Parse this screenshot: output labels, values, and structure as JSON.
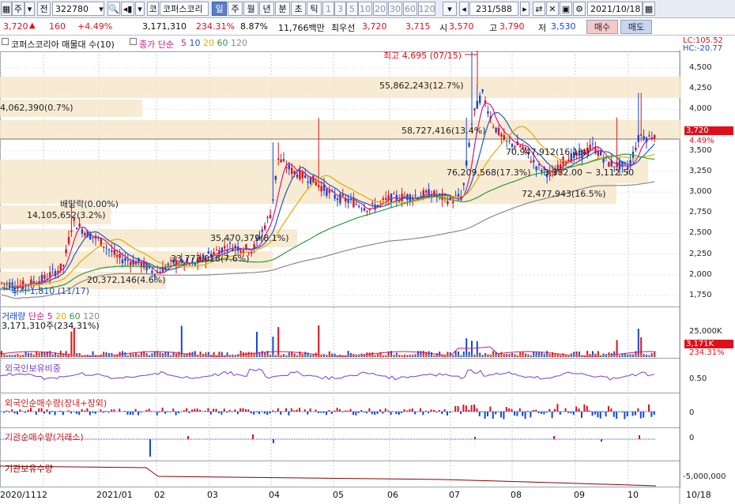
{
  "toolbar": {
    "mode_label": "주",
    "market_label": "전",
    "stock_code": "322780",
    "search_icon": "magnifier-icon",
    "sound_icon": "speaker-icon",
    "code_tag": "코",
    "stock_name": "코퍼스코리",
    "periods": [
      "일",
      "주",
      "월",
      "년",
      "분",
      "초",
      "틱"
    ],
    "active_period": "일",
    "intervals": [
      "1",
      "3",
      "5",
      "10",
      "20",
      "30",
      "60",
      "120"
    ],
    "count": "231/588",
    "date": "2021/10/18"
  },
  "quote": {
    "price": "3,720",
    "change_arrow": "▲",
    "change": "160",
    "change_pct": "+4.49%",
    "volume": "3,171,310",
    "volume_ratio": "234.31%",
    "turnover": "8.87%",
    "amount": "11,766백만",
    "best_label": "최우선",
    "best_ask": "3,720",
    "best_bid": "3,715",
    "open_label": "시",
    "open": "3,570",
    "high_label": "고",
    "high": "3,790",
    "low_label": "저",
    "low": "3,530",
    "buy_label": "매수",
    "sell_label": "매도"
  },
  "legend": {
    "title": "코퍼스코리아 매물대 수(10)",
    "ma_label": "종가 단순",
    "ma_periods": [
      "5",
      "10",
      "20",
      "60",
      "120"
    ],
    "ma_colors": [
      "#d01a86",
      "#1c58c8",
      "#e8a800",
      "#2e9a3c",
      "#8a8a8a"
    ],
    "lc": "LC:105.52",
    "hc": "HC:-20.77"
  },
  "price_panel": {
    "annotations": [
      "최고 4,695 (07/15)",
      "55,862,243(12.7%)",
      "4,062,390(0.7%)",
      "58,727,416(13.4%)",
      "70,947,912(16.1%)",
      "76,209,568(17.3%)",
      "3,382.00 ~ 3,112.50",
      "72,477,943(16.5%)",
      "배당락(0.00%)",
      "14,105,652(3.2%)",
      "35,470,379(8.1%)",
      "33,773,018(7.6%)",
      "20,372,146(4.6%)",
      "최저 1,810 (11/17)"
    ],
    "y_axis": [
      "4,500",
      "4,250",
      "4,000",
      "3,750",
      "3,500",
      "3,250",
      "3,000",
      "2,750",
      "2,500",
      "2,250",
      "2,000",
      "1,750"
    ],
    "current_price_tag": "3,720",
    "current_pct_tag": "4.49%"
  },
  "volume_panel": {
    "title_prefix": "거래량",
    "ma_label": "단순",
    "ma_periods": [
      "5",
      "20",
      "60",
      "120"
    ],
    "value_text": "3,171,310주(234.31%)",
    "axis_label": "25,000K",
    "tag_value": "3,171K",
    "tag_pct": "234.31%"
  },
  "foreign_ratio_panel": {
    "title": "외국인보유비중",
    "axis_label": "0.50"
  },
  "foreign_net_panel": {
    "title": "외국인순매수량(장내+장외)",
    "axis_label": "0"
  },
  "inst_net_panel": {
    "title": "기관순매수량(거래소)",
    "axis_label": "0"
  },
  "inst_hold_panel": {
    "title": "기관보유수량",
    "axis_label": "-5,000,000"
  },
  "x_axis": [
    "2020/11",
    "12",
    "2021/01",
    "02",
    "03",
    "04",
    "05",
    "06",
    "07",
    "08",
    "09",
    "10",
    "10/18"
  ],
  "chart_data": {
    "type": "line",
    "title": "코퍼스코리아 매물대 수(10)",
    "approx_close": [
      {
        "x": "2020/11",
        "y": 1900
      },
      {
        "x": "12",
        "y": 1950
      },
      {
        "x": "2021/01",
        "y": 2300
      },
      {
        "x": "02",
        "y": 2050
      },
      {
        "x": "03",
        "y": 2200
      },
      {
        "x": "04",
        "y": 3400
      },
      {
        "x": "05",
        "y": 2850
      },
      {
        "x": "06",
        "y": 2950
      },
      {
        "x": "07",
        "y": 3750
      },
      {
        "x": "08",
        "y": 3300
      },
      {
        "x": "09",
        "y": 3400
      },
      {
        "x": "10",
        "y": 3500
      },
      {
        "x": "10/18",
        "y": 3720
      }
    ],
    "ylim": [
      1700,
      4700
    ],
    "high": {
      "value": 4695,
      "date": "07/15"
    },
    "low": {
      "value": 1810,
      "date": "11/17"
    }
  }
}
